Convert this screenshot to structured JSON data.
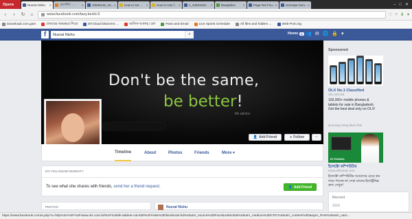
{
  "browser": {
    "menu_label": "Opera",
    "tabs": [
      {
        "label": "Nusrat Nishu",
        "active": true
      },
      {
        "label": "মেসেজিং - ..."
      },
      {
        "label": "10836145_15..."
      },
      {
        "label": "How to set ..."
      },
      {
        "label": "How to Use f..."
      },
      {
        "label": "1_34531620..."
      },
      {
        "label": "Banglalion"
      },
      {
        "label": "Page Not Fou..."
      },
      {
        "label": "Sumaiya Sum..."
      }
    ],
    "url": "www.facebook.com/lazy.keshi.9",
    "bookmarks": [
      "Download.com.gam",
      "প্রজন্মের অভ্যন্তরে শিরো",
      "BTCloud bittorrent ...",
      "আলিফ আলাহ / ব্লগ",
      "Pass and Email",
      "Live Sports Schedule",
      "All files and folders ...",
      "Web-Port.org"
    ]
  },
  "facebook": {
    "logo": "f",
    "search_value": "Nusrat Nishu",
    "home_label": "Home",
    "home_count": "4"
  },
  "cover": {
    "line1": "Don't be the same,",
    "line2_green": "be better",
    "line2_end": "!",
    "line3": "life advice",
    "add_friend": "Add Friend",
    "follow": "Follow",
    "more": "···"
  },
  "profile_tabs": [
    "Timeline",
    "About",
    "Photos",
    "Friends",
    "More ▾"
  ],
  "know_card": {
    "header": "DO YOU KNOW NUSRAT?",
    "text": "To see what she shares with friends,",
    "link": "send her a friend request.",
    "button": "Add Friend"
  },
  "photos_header": "PHOTOS",
  "post_author": "Nusrat Nishu",
  "sidebar": {
    "sponsored": "Sponsored",
    "ad1": {
      "title": "OLX No.1 Classified",
      "domain": "olx.com.bd",
      "text": "100,000+ mobile phones & tablets for sale in Bangladesh. Get the best deal only on OLX!",
      "social": "Sumaiya Shaj likes this"
    },
    "ad2": {
      "image_label": "ELTHANAL",
      "title": "ইলেক্টো কম্পিউটার",
      "domain": "www.elthanal.com",
      "text": "ইলেক্টো কম্পিউটার আমাদের চেয়ে কম দামে পাবেন না সেরা মানের ইলেক্ট্রনিক্স দ্রুত দেখুন!"
    },
    "recent_header": "Recent",
    "recent_year": "2016"
  },
  "status_url": "https://www.facebook.com/a.php?u=http%3A%2F%2Fwww.olx.com.bd%2Fmobile-tablets-cat-830%3Finvite%3Dfacebook-bd%26utm_source%3DFacebookSolrat%26utm_medium%3DCPC%26utm_content%3D&ayer_RHS%26utm_cam..."
}
